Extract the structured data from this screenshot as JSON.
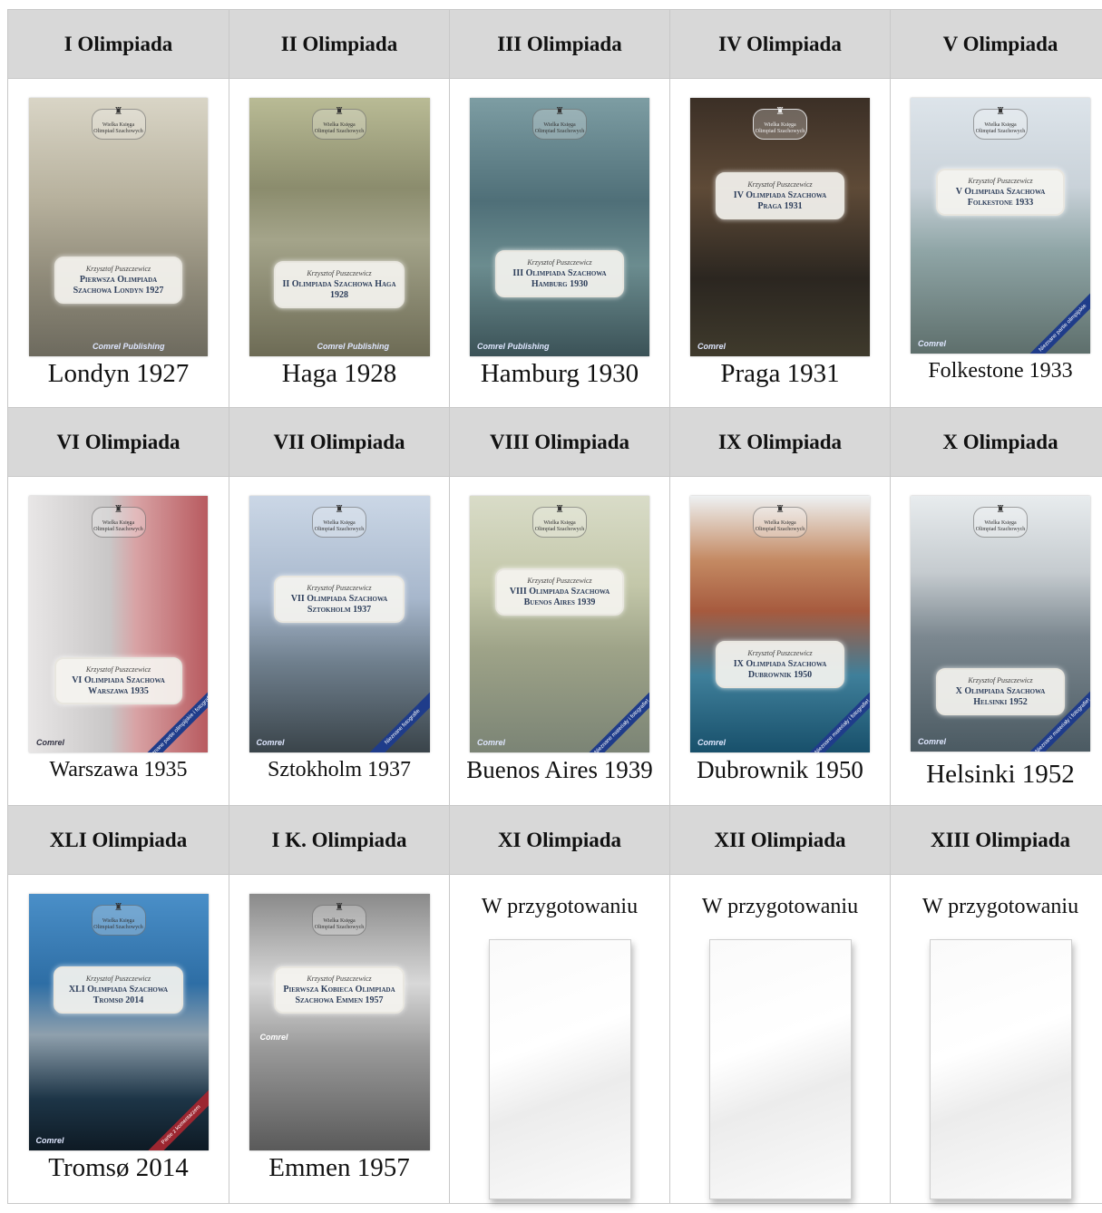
{
  "rows": [
    {
      "headers": [
        "I Olimpiada",
        "II Olimpiada",
        "III Olimpiada",
        "IV Olimpiada",
        "V Olimpiada"
      ],
      "captions": [
        "Londyn 1927",
        "Haga 1928",
        "Hamburg 1930",
        "Praga 1931",
        "Folkestone 1933"
      ],
      "covers": [
        {
          "author": "Krzysztof Puszczewicz",
          "title": "Pierwsza Olimpiada Szachowa Londyn 1927",
          "logo": "Comrel Publishing"
        },
        {
          "author": "Krzysztof Puszczewicz",
          "title": "II Olimpiada Szachowa Haga 1928",
          "logo": "Comrel Publishing"
        },
        {
          "author": "Krzysztof Puszczewicz",
          "title": "III Olimpiada Szachowa Hamburg 1930",
          "logo": "Comrel Publishing"
        },
        {
          "author": "Krzysztof Puszczewicz",
          "title": "IV Olimpiada Szachowa Praga 1931",
          "logo": "Comrel"
        },
        {
          "author": "Krzysztof Puszczewicz",
          "title": "V Olimpiada Szachowa Folkestone 1933",
          "logo": "Comrel",
          "ribbon": "Nieznane partie olimpijskie"
        }
      ]
    },
    {
      "headers": [
        "VI Olimpiada",
        "VII Olimpiada",
        "VIII Olimpiada",
        "IX Olimpiada",
        "X Olimpiada"
      ],
      "captions": [
        "Warszawa 1935",
        "Sztokholm 1937",
        "Buenos Aires 1939",
        "Dubrownik 1950",
        "Helsinki 1952"
      ],
      "covers": [
        {
          "author": "Krzysztof Puszczewicz",
          "title": "VI Olimpiada Szachowa Warszawa 1935",
          "logo": "Comrel",
          "ribbon": "Nieznane partie olimpijskie i fotografie!"
        },
        {
          "author": "Krzysztof Puszczewicz",
          "title": "VII Olimpiada Szachowa Sztokholm 1937",
          "logo": "Comrel",
          "ribbon": "Nieznane fotografie"
        },
        {
          "author": "Krzysztof Puszczewicz",
          "title": "VIII Olimpiada Szachowa Buenos Aires 1939",
          "logo": "Comrel",
          "ribbon": "Nieznane materiały i fotografie!"
        },
        {
          "author": "Krzysztof Puszczewicz",
          "title": "IX Olimpiada Szachowa Dubrownik 1950",
          "logo": "Comrel",
          "ribbon": "Nieznane materiały i fotografie!"
        },
        {
          "author": "Krzysztof Puszczewicz",
          "title": "X Olimpiada Szachowa Helsinki 1952",
          "logo": "Comrel",
          "ribbon": "Nieznane materiały i fotografie!"
        }
      ]
    },
    {
      "headers": [
        "XLI Olimpiada",
        "I K. Olimpiada",
        "XI Olimpiada",
        "XII Olimpiada",
        "XIII Olimpiada"
      ],
      "captions": [
        "Tromsø 2014",
        "Emmen 1957"
      ],
      "covers": [
        {
          "author": "Krzysztof Puszczewicz",
          "title": "XLI Olimpiada Szachowa Tromsø 2014",
          "logo": "Comrel",
          "ribbon": "Partie z komentarzem"
        },
        {
          "author": "Krzysztof Puszczewicz",
          "title": "Pierwsza Kobieca Olimpiada Szachowa Emmen 1957",
          "logo": "Comrel"
        }
      ],
      "pending": [
        "W przygotowaniu",
        "W przygotowaniu",
        "W przygotowaniu"
      ]
    }
  ],
  "emblem": "Wielka Księga Olimpiad Szachowych",
  "colors": {
    "header_bg": "#d8d8d8",
    "grid_line": "#c8c8c8"
  }
}
